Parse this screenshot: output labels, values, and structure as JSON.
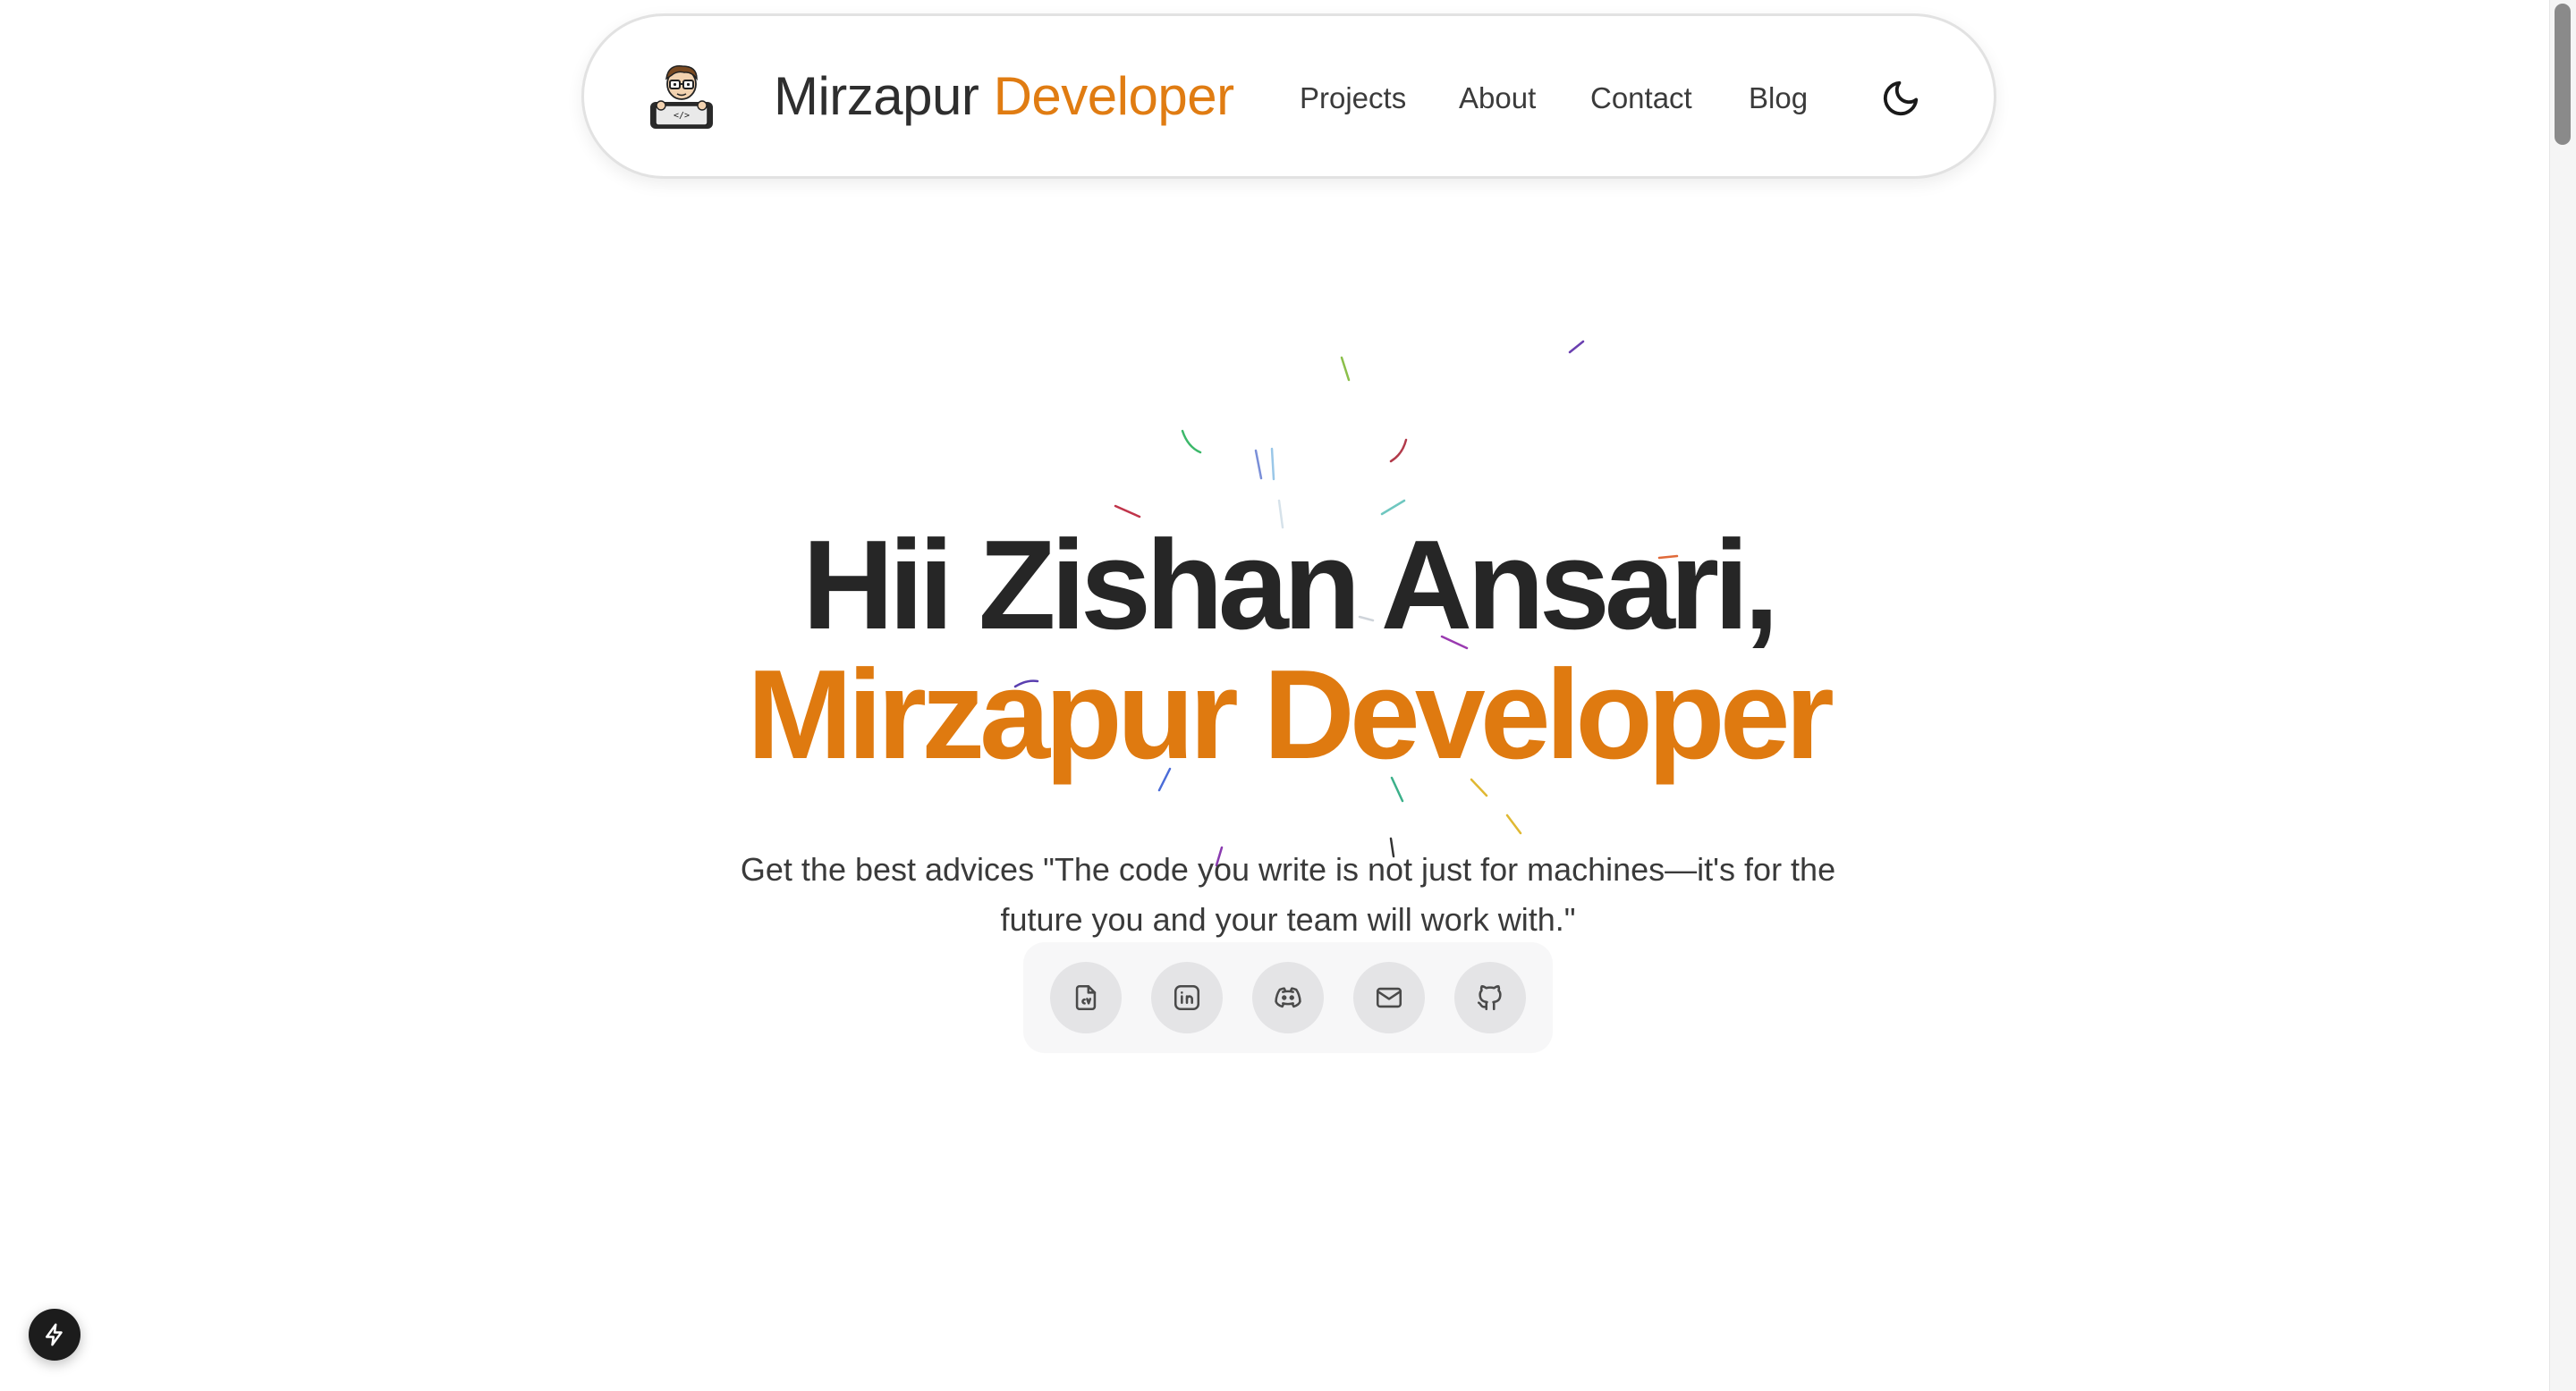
{
  "header": {
    "brand_name": "Mirzapur",
    "brand_accent": "Developer",
    "nav": [
      {
        "label": "Projects"
      },
      {
        "label": "About"
      },
      {
        "label": "Contact"
      },
      {
        "label": "Blog"
      }
    ],
    "theme_toggle_icon": "moon-icon"
  },
  "hero": {
    "greeting": "Hii Zishan Ansari,",
    "title": "Mirzapur Developer",
    "tagline": "Get the best advices \"The code you write is not just for machines—it's for the future you and your team will work with.\""
  },
  "socials": [
    {
      "icon": "resume-cv-icon"
    },
    {
      "icon": "linkedin-icon"
    },
    {
      "icon": "discord-icon"
    },
    {
      "icon": "mail-icon"
    },
    {
      "icon": "github-icon"
    }
  ],
  "colors": {
    "accent": "#e07c12",
    "text_dark": "#262626",
    "text_body": "#3a3a3a"
  }
}
